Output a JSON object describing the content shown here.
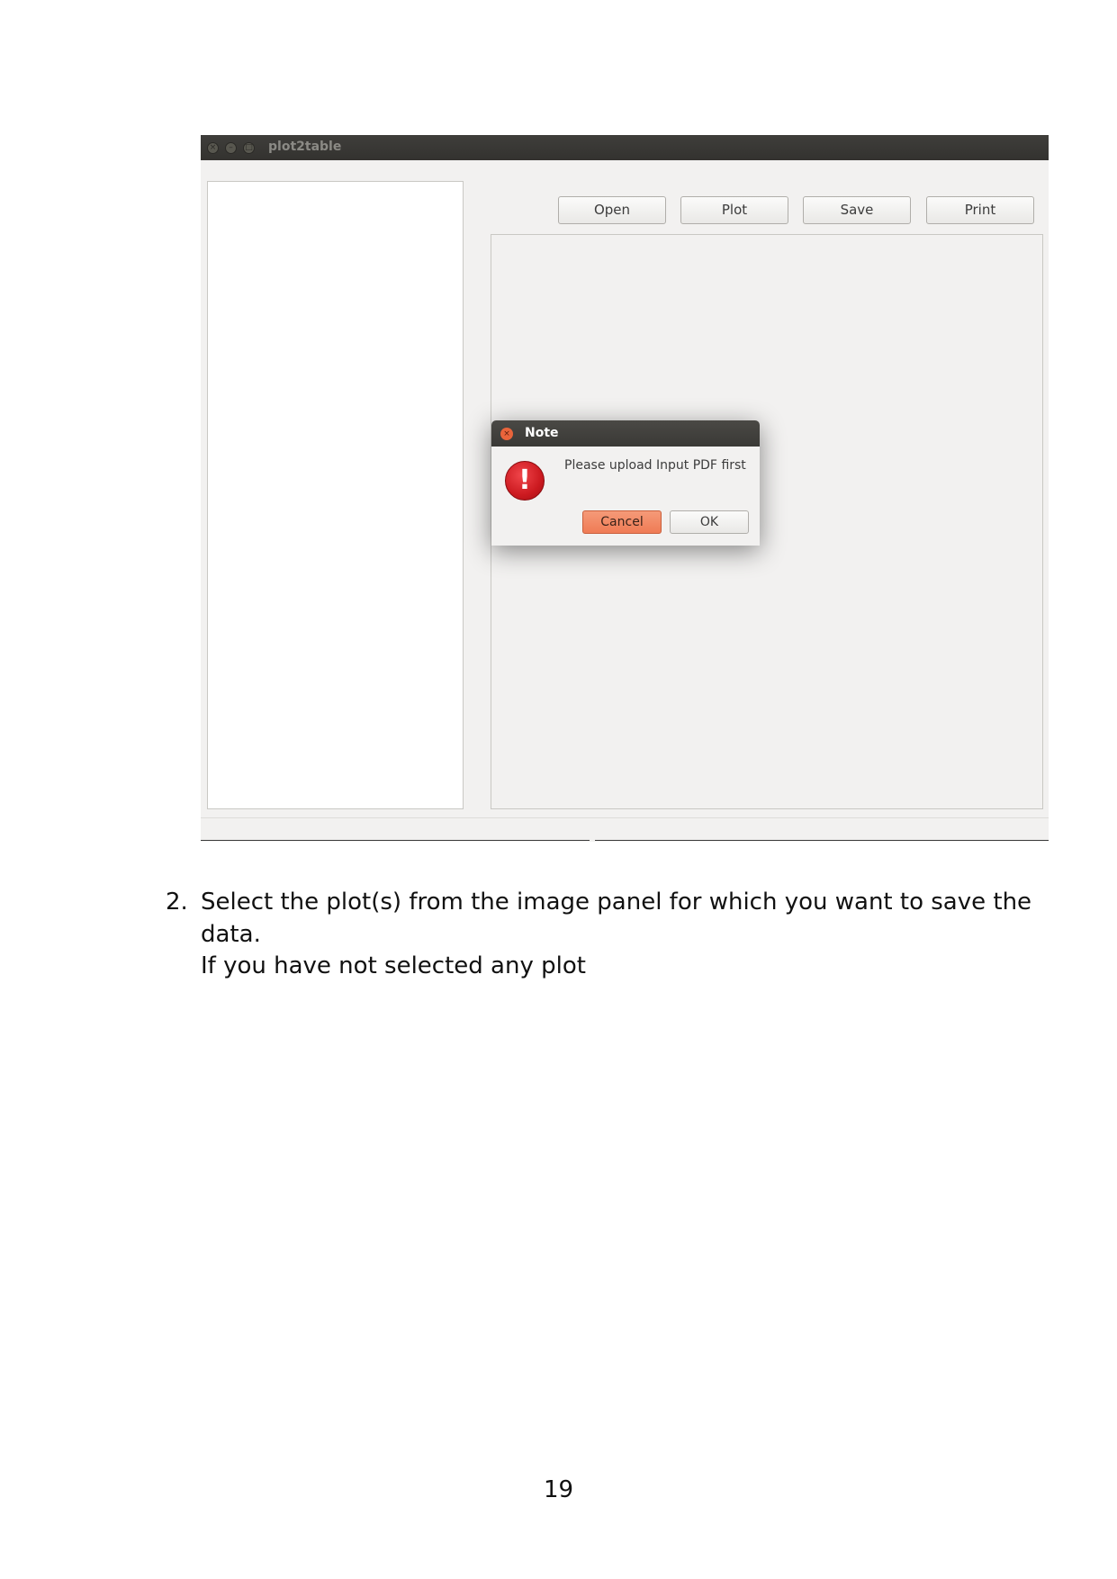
{
  "window": {
    "title": "plot2table",
    "toolbar": {
      "open": "Open",
      "plot": "Plot",
      "save": "Save",
      "print": "Print"
    }
  },
  "dialog": {
    "title": "Note",
    "message": "Please upload Input PDF first",
    "cancel_label": "Cancel",
    "ok_label": "OK",
    "cancel_color": "#ef7b55"
  },
  "document": {
    "item_number": "2.",
    "line1": "Select the plot(s) from the image panel for which you want to save the",
    "line2": "data.",
    "line3": "If you have not selected any plot",
    "page_number": "19"
  }
}
